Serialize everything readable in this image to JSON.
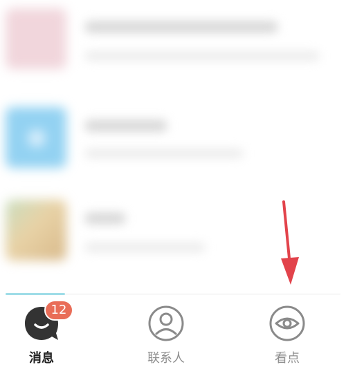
{
  "tabbar": {
    "tabs": [
      {
        "label": "消息",
        "icon": "chat-bubble-icon",
        "active": true,
        "badge": "12"
      },
      {
        "label": "联系人",
        "icon": "contacts-icon",
        "active": false
      },
      {
        "label": "看点",
        "icon": "eye-icon",
        "active": false
      }
    ]
  },
  "colors": {
    "badge": "#e96d58",
    "arrow": "#e2434b",
    "active_text": "#222222",
    "inactive_text": "#8f8f8f"
  }
}
